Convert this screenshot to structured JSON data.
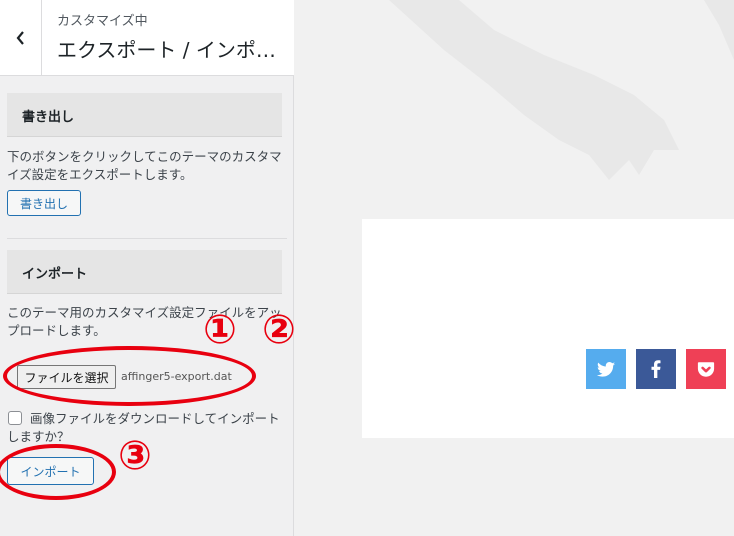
{
  "header": {
    "subtitle": "カスタマイズ中",
    "title": "エクスポート / インポート"
  },
  "export_section": {
    "heading": "書き出し",
    "description": "下のボタンをクリックしてこのテーマのカスタマイズ設定をエクスポートします。",
    "button_label": "書き出し"
  },
  "import_section": {
    "heading": "インポート",
    "description": "このテーマ用のカスタマイズ設定ファイルをアップロードします。",
    "file_button_label": "ファイルを選択",
    "file_name": "affinger5-export.dat",
    "checkbox_label": "画像ファイルをダウンロードしてインポートしますか？",
    "checkbox_checked": false,
    "button_label": "インポート"
  },
  "annotations": {
    "marker_1": "①",
    "marker_2": "②",
    "marker_3": "③",
    "color": "#e8000f"
  },
  "share_buttons": [
    {
      "icon": "twitter-icon",
      "color": "#55acee"
    },
    {
      "icon": "facebook-icon",
      "color": "#3b5998"
    },
    {
      "icon": "pocket-icon",
      "color": "#ef4056"
    }
  ]
}
